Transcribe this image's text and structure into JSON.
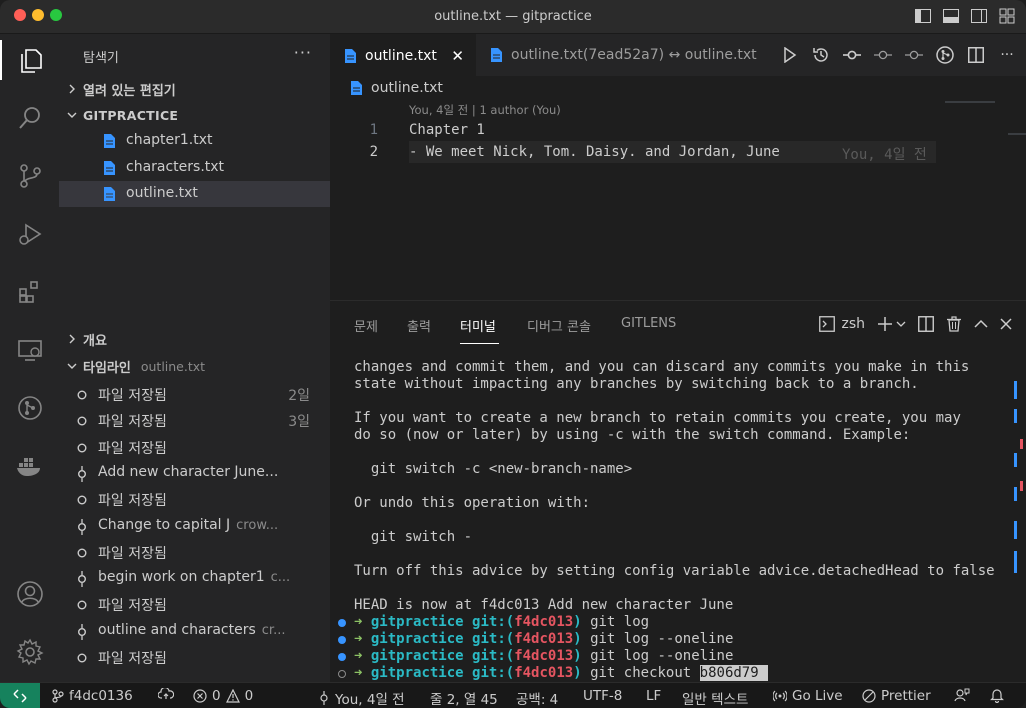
{
  "window": {
    "title": "outline.txt — gitpractice"
  },
  "sidebar": {
    "title": "탐색기",
    "more": "···",
    "open_editors": "열려 있는 편집기",
    "repo": "GITPRACTICE",
    "files": [
      "chapter1.txt",
      "characters.txt",
      "outline.txt"
    ],
    "selected_file": "outline.txt",
    "outline_section": "개요",
    "timeline_section": "타임라인",
    "timeline_file": "outline.txt",
    "timeline": [
      {
        "label": "파일 저장됨",
        "author": "",
        "time": "2일",
        "kind": "save"
      },
      {
        "label": "파일 저장됨",
        "author": "",
        "time": "3일",
        "kind": "save"
      },
      {
        "label": "파일 저장됨",
        "author": "",
        "time": "",
        "kind": "save"
      },
      {
        "label": "Add new character June...",
        "author": "",
        "time": "",
        "kind": "commit"
      },
      {
        "label": "파일 저장됨",
        "author": "",
        "time": "",
        "kind": "save"
      },
      {
        "label": "Change to capital J",
        "author": "crow...",
        "time": "",
        "kind": "commit"
      },
      {
        "label": "파일 저장됨",
        "author": "",
        "time": "",
        "kind": "save"
      },
      {
        "label": "begin work on chapter1",
        "author": "c...",
        "time": "",
        "kind": "commit"
      },
      {
        "label": "파일 저장됨",
        "author": "",
        "time": "",
        "kind": "save"
      },
      {
        "label": "outline and characters",
        "author": "cr...",
        "time": "",
        "kind": "commit"
      },
      {
        "label": "파일 저장됨",
        "author": "",
        "time": "",
        "kind": "save"
      }
    ]
  },
  "tabs": [
    {
      "label": "outline.txt",
      "active": true,
      "close": "✕"
    },
    {
      "label": "outline.txt(7ead52a7) ↔ outline.txt",
      "active": false
    }
  ],
  "editor": {
    "breadcrumb": "outline.txt",
    "codelens": "You, 4일 전 | 1 author (You)",
    "lines": [
      {
        "num": "1",
        "text": "Chapter 1"
      },
      {
        "num": "2",
        "text": "- We meet Nick, Tom. Daisy. and Jordan, June"
      }
    ],
    "blame": "You, 4일 전"
  },
  "panel": {
    "tabs": [
      "문제",
      "출력",
      "터미널",
      "디버그 콘솔",
      "GITLENS"
    ],
    "active_tab": "터미널",
    "shell": "zsh",
    "terminal": {
      "lines": [
        "changes and commit them, and you can discard any commits you make in this",
        "state without impacting any branches by switching back to a branch.",
        "",
        "If you want to create a new branch to retain commits you create, you may",
        "do so (now or later) by using -c with the switch command. Example:",
        "",
        "  git switch -c <new-branch-name>",
        "",
        "Or undo this operation with:",
        "",
        "  git switch -",
        "",
        "Turn off this advice by setting config variable advice.detachedHead to false",
        "",
        "HEAD is now at f4dc013 Add new character June"
      ],
      "prompts": [
        {
          "arrow": "➜",
          "dir": "gitpractice",
          "git": "git:(",
          "branch": "f4dc013",
          "close": ")",
          "cmd": "git log",
          "sel": ""
        },
        {
          "arrow": "➜",
          "dir": "gitpractice",
          "git": "git:(",
          "branch": "f4dc013",
          "close": ")",
          "cmd": "git log --oneline",
          "sel": ""
        },
        {
          "arrow": "➜",
          "dir": "gitpractice",
          "git": "git:(",
          "branch": "f4dc013",
          "close": ")",
          "cmd": "git log --oneline",
          "sel": ""
        },
        {
          "arrow": "➜",
          "dir": "gitpractice",
          "git": "git:(",
          "branch": "f4dc013",
          "close": ")",
          "cmd": "git checkout ",
          "sel": "b806d79 "
        }
      ]
    }
  },
  "statusbar": {
    "branch": "f4dc0136",
    "errors": "0",
    "warnings": "0",
    "blame": "You, 4일 전",
    "position": "줄 2, 열 45",
    "spaces": "공백: 4",
    "encoding": "UTF-8",
    "eol": "LF",
    "language": "일반 텍스트",
    "golive": "Go Live",
    "prettier": "Prettier"
  },
  "colors": {
    "accent": "#3794ff",
    "remote": "#16825d",
    "prompt_dir": "#2bbac5",
    "prompt_branch": "#e55561",
    "prompt_arrow": "#8cc265"
  }
}
